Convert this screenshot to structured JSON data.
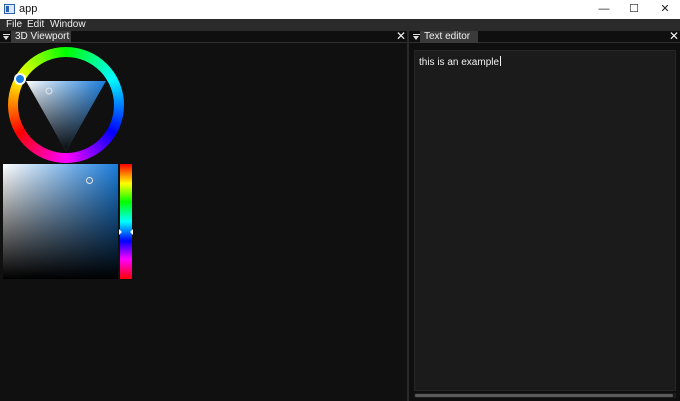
{
  "window": {
    "title": "app",
    "minimize_glyph": "—",
    "maximize_glyph": "☐",
    "close_glyph": "✕"
  },
  "menubar": {
    "items": [
      "File",
      "Edit",
      "Window"
    ]
  },
  "left_panel": {
    "tab_label": "3D Viewport",
    "close_glyph": "✕",
    "color_picker": {
      "selected_color": "#1a7ddc",
      "hue_marker_color": "#1e7de0"
    }
  },
  "right_panel": {
    "tab_label": "Text editor",
    "close_glyph": "✕",
    "editor_text": "this is an example"
  }
}
